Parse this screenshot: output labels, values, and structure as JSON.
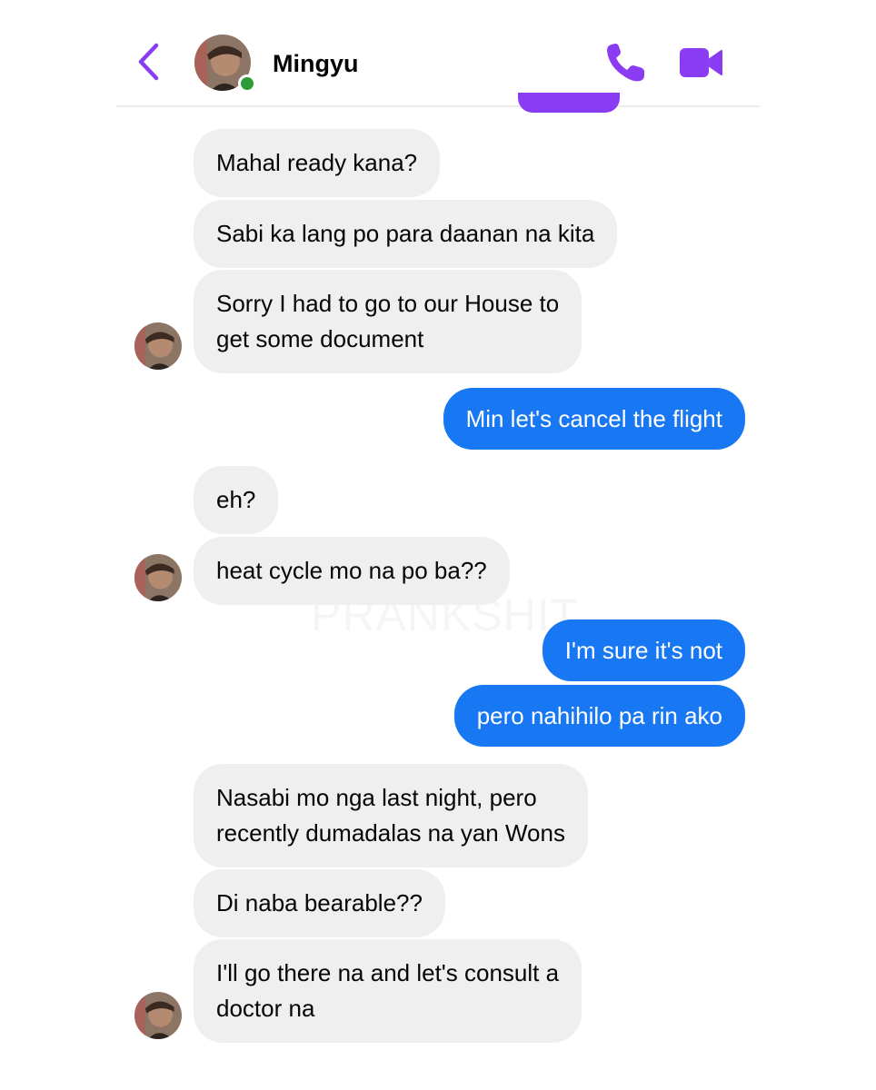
{
  "header": {
    "contact_name": "Mingyu",
    "accent_color": "#8a3cf2",
    "online_color": "#2e9c36",
    "icons": [
      "back-chevron-icon",
      "phone-icon",
      "video-camera-icon"
    ]
  },
  "messages": [
    {
      "sender": "contact",
      "text": "Mahal ready kana?"
    },
    {
      "sender": "contact",
      "text": "Sabi ka lang po para daanan na kita"
    },
    {
      "sender": "contact",
      "lines": [
        "Sorry I had to go to our House to",
        "get some document"
      ]
    },
    {
      "sender": "me",
      "text": "Min let's cancel the flight"
    },
    {
      "sender": "contact",
      "text": "eh?"
    },
    {
      "sender": "contact",
      "text": "heat cycle mo na po ba??"
    },
    {
      "sender": "me",
      "text": "I'm sure it's not"
    },
    {
      "sender": "me",
      "text": "pero nahihilo pa rin ako"
    },
    {
      "sender": "contact",
      "lines": [
        "Nasabi mo nga last night, pero",
        "recently dumadalas na yan Wons"
      ]
    },
    {
      "sender": "contact",
      "text": "Di naba bearable??"
    },
    {
      "sender": "contact",
      "lines": [
        "I'll go there na and let's consult a",
        "doctor na"
      ]
    }
  ],
  "colors": {
    "incoming_bubble": "#efefef",
    "outgoing_bubble": "#1877f2"
  },
  "watermark": "PRANKSHIT"
}
